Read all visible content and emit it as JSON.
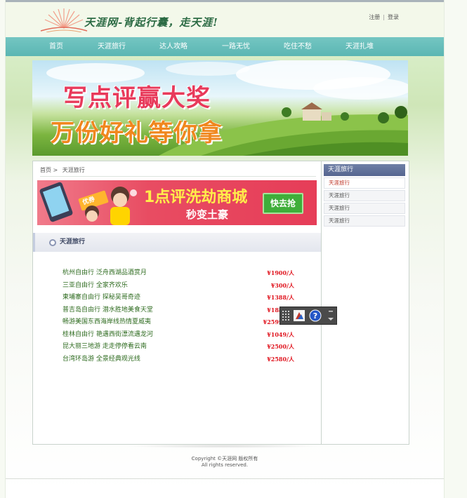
{
  "header": {
    "slogan": "天涯网-背起行囊，走天涯!",
    "register": "注册",
    "login": "登录"
  },
  "nav": {
    "items": [
      "首页",
      "天涯旅行",
      "达人攻略",
      "一路无忧",
      "吃住不愁",
      "天涯扎堆"
    ]
  },
  "banner": {
    "line1": "写点评赢大奖",
    "line2": "万份好礼等你拿"
  },
  "breadcrumb": {
    "home": "首页",
    "sep": ">",
    "current": "天涯旅行"
  },
  "promo": {
    "main": "1点评洗劫商城",
    "sub": "秒变土豪",
    "button": "快去抢",
    "tag": "优券"
  },
  "section": {
    "title": "天涯旅行"
  },
  "trips": [
    {
      "name": "杭州自由行 泛舟西湖品酒赏月",
      "price": "¥1900/人"
    },
    {
      "name": "三亚自由行 全家齐欢乐",
      "price": "¥300/人"
    },
    {
      "name": "柬埔寨自由行 探秘吴哥奇迹",
      "price": "¥1388/人"
    },
    {
      "name": "普吉岛自由行 潜水胜地美食天堂",
      "price": "¥1888/人"
    },
    {
      "name": "畅游美国东西海岸线热情夏威夷",
      "price": "¥25999/人"
    },
    {
      "name": "桂林自由行 艳遇西街漂流遇龙河",
      "price": "¥1049/人"
    },
    {
      "name": "昆大丽三地游 走走停停看云南",
      "price": "¥2500/人"
    },
    {
      "name": "台湾环岛游 全景经典观光线",
      "price": "¥2580/人"
    }
  ],
  "sidebar": {
    "title": "天涯旅行",
    "items": [
      "天涯旅行",
      "天涯旅行",
      "天涯旅行",
      "天涯旅行"
    ]
  },
  "footer": {
    "line1": "Copyright ©天涯网 版权所有",
    "line2": "All rights reserved."
  },
  "colors": {
    "nav": "#5bb6b3",
    "price": "#e0141e",
    "trip_link": "#2e6b1f",
    "sidebar_head": "#556590"
  }
}
